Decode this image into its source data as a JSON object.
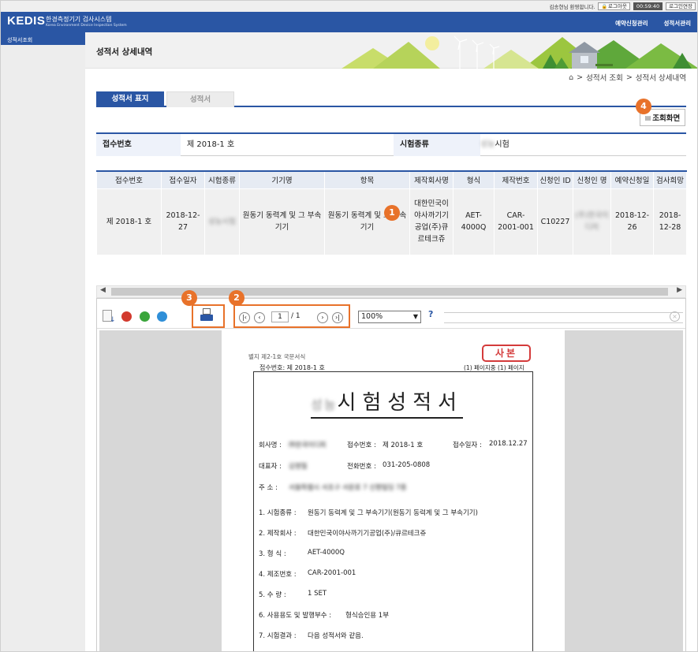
{
  "topbar": {
    "welcome": "김송현님 환영합니다.",
    "logout": "로그아웃",
    "timer": "00:59:40",
    "extend": "로그인연장"
  },
  "header": {
    "logo": "KEDIS",
    "title_ko": "한경측정기기 검사시스템",
    "title_en": "Korea Environment Device Inspection System",
    "gnb": [
      "예약신청관리",
      "성적서관리"
    ]
  },
  "sidebar": {
    "items": [
      {
        "label": "성적서조회",
        "active": true
      }
    ]
  },
  "page": {
    "title": "성적서 상세내역",
    "breadcrumb": [
      "성적서 조회",
      "성적서 상세내역"
    ]
  },
  "tabs": [
    {
      "label": "성적서 표지",
      "active": true
    },
    {
      "label": "성적서",
      "active": false
    }
  ],
  "view_button": {
    "label": "조회화면"
  },
  "info": {
    "receipt_label": "접수번호",
    "receipt_value": "제 2018-1 호",
    "test_type_label": "시험종류",
    "test_type_value": "시험",
    "test_type_blur": "성능"
  },
  "table": {
    "headers": [
      "접수번호",
      "접수일자",
      "시험종류",
      "기기명",
      "항목",
      "제작회사명",
      "형식",
      "제작번호",
      "신청인 ID",
      "신청인 명",
      "예약신청일",
      "검사희망"
    ],
    "row": {
      "receipt": "제 2018-1 호",
      "date": "2018-12-27",
      "type_blur": "성능시험",
      "device": "원동기 동력계 및 그 부속기기",
      "item": "원동기 동력계 및 그 부속기기",
      "maker": "대한민국이야사까기기공업(주)큐르테크쥬",
      "model": "AET-4000Q",
      "serial": "CAR-2001-001",
      "applicant_id": "C10227",
      "applicant_name_blur": "(주)한국이디피",
      "reserve_date": "2018-12-26",
      "hope_date": "2018-12-28"
    }
  },
  "callouts": [
    "1",
    "2",
    "3",
    "4"
  ],
  "viewer": {
    "page_current": "1",
    "page_total": "/ 1",
    "zoom": "100%"
  },
  "doc": {
    "form_no": "별지 제2-1호 국문서식",
    "stamp": "사본",
    "receipt_line": "접수번호:  제 2018-1 호",
    "page_line": "(1) 페이지중 (1) 페이지",
    "title_blur": "성능",
    "title": "시험성적서",
    "company_label": "회사명 :",
    "company_value_blur": "㈜한국이디피",
    "receipt_no_label": "접수번호 :",
    "receipt_no_value": "제 2018-1 호",
    "receipt_date_label": "접수일자 :",
    "receipt_date_value": "2018.12.27",
    "ceo_label": "대표자 :",
    "ceo_value_blur": "김영철",
    "phone_label": "전화번호 :",
    "phone_value": "031-205-0808",
    "addr_label": "주  소 :",
    "addr_value_blur": "서울특별시 서초구 서운로 7 신평빌딩 7층",
    "items": [
      {
        "label": "1. 시험종류 :",
        "value": "원동기 동력계 및 그 부속기기(원동기 동력계 및 그 부속기기)"
      },
      {
        "label": "2. 제작회사 :",
        "value": "대한민국이야사까기기공업(주)/큐르테크쥬"
      },
      {
        "label": "3. 형    식 :",
        "value": "AET-4000Q"
      },
      {
        "label": "4. 제조번호 :",
        "value": "CAR-2001-001"
      },
      {
        "label": "5. 수    량 :",
        "value": "1 SET"
      },
      {
        "label": "6. 사용용도 및 발행부수 :",
        "value": "형식승인용 1부"
      },
      {
        "label": "7. 시험결과 :",
        "value": "다음 성적서와 같음."
      }
    ]
  },
  "colors": {
    "primary": "#2a56a4",
    "accent": "#e8722a",
    "stamp": "#d43b3b"
  }
}
